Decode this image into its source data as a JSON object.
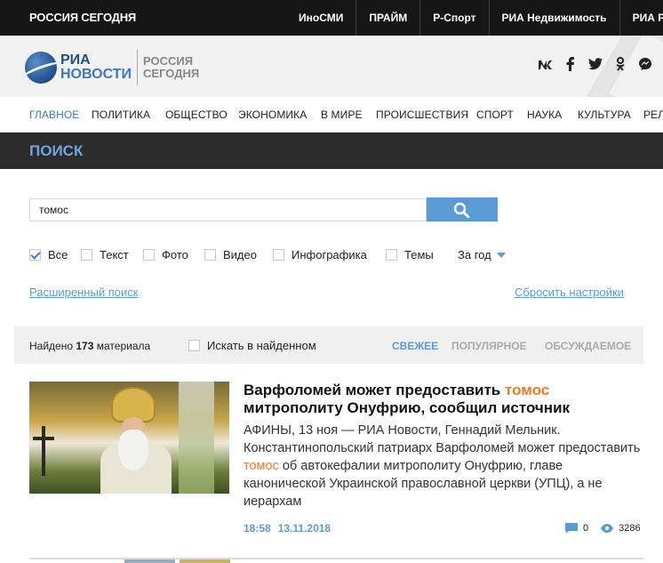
{
  "topbar": {
    "brand": "РОССИЯ СЕГОДНЯ",
    "links": [
      "ИноСМИ",
      "ПРАЙМ",
      "Р-Спорт",
      "РИА Недвижимость",
      "РИА Ре"
    ]
  },
  "header": {
    "logo_ria": "РИА",
    "logo_novosti": "НОВОСТИ",
    "logo_rossiya": "РОССИЯ",
    "logo_segodnya": "СЕГОДНЯ",
    "social": [
      "vk-icon",
      "facebook-icon",
      "twitter-icon",
      "odnoklassniki-icon",
      "messenger-icon"
    ]
  },
  "nav": {
    "items": [
      "ГЛАВНОЕ",
      "ПОЛИТИКА",
      "ОБЩЕСТВО",
      "ЭКОНОМИКА",
      "В МИРЕ",
      "ПРОИСШЕСТВИЯ",
      "СПОРТ",
      "НАУКА",
      "КУЛЬТУРА",
      "РЕЛ"
    ],
    "active": "ГЛАВНОЕ"
  },
  "page_title": "ПОИСК",
  "search": {
    "value": "томос",
    "button_icon": "search-icon"
  },
  "filters": {
    "items": [
      {
        "label": "Все",
        "checked": true
      },
      {
        "label": "Текст",
        "checked": false
      },
      {
        "label": "Фото",
        "checked": false
      },
      {
        "label": "Видео",
        "checked": false
      },
      {
        "label": "Инфографика",
        "checked": false
      },
      {
        "label": "Темы",
        "checked": false
      }
    ],
    "period": "За год"
  },
  "links": {
    "advanced": "Расширенный поиск",
    "reset": "Сбросить настройки"
  },
  "results": {
    "found_prefix": "Найдено",
    "found_count": "173",
    "found_suffix": "материала",
    "search_within": "Искать в найденном",
    "sort": [
      "СВЕЖЕЕ",
      "ПОПУЛЯРНОЕ",
      "ОБСУЖДАЕМОЕ"
    ],
    "sort_active": "СВЕЖЕЕ"
  },
  "article": {
    "title_before": "Варфоломей может предоставить ",
    "title_highlight": "томос",
    "title_after": " митрополиту Онуфрию, сообщил источник",
    "text_before": "АФИНЫ, 13 ноя — РИА Новости, Геннадий Мельник. Константинопольский патриарх Варфоломей может предоставить ",
    "text_highlight": "томос",
    "text_after": " об автокефалии митрополиту Онуфрию, главе канонической Украинской православной церкви (УПЦ), а не иерархам",
    "time": "18:58",
    "date": "13.11.2018",
    "comments": "0",
    "views": "3286"
  }
}
